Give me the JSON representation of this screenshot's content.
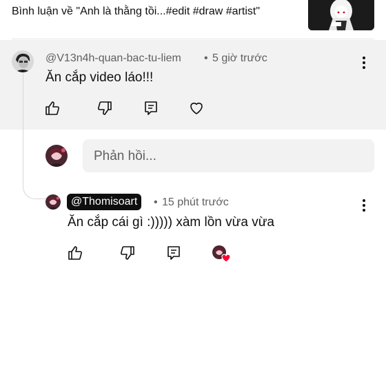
{
  "header": {
    "title": "Bình luận về \"Anh là thằng tồi...#edit #draw #artist\"",
    "thumbnail_icon": "video-thumbnail"
  },
  "comment": {
    "author": "@V13n4h-quan-bac-tu-liem",
    "separator": "•",
    "time": "5 giờ trước",
    "text": "Ăn cắp video láo!!!",
    "actions": [
      "like-icon",
      "dislike-icon",
      "reply-icon",
      "heart-icon"
    ]
  },
  "reply_input": {
    "placeholder": "Phản hồi..."
  },
  "reply": {
    "author": "@Thomisoart",
    "separator": "•",
    "time": "15 phút trước",
    "text": "Ăn cắp cái gì :))))) xàm lồn vừa vừa",
    "actions": [
      "like-icon",
      "dislike-icon",
      "reply-icon",
      "creator-heart-icon"
    ]
  },
  "colors": {
    "highlight_bg": "#f2f2f2",
    "secondary_text": "#606060",
    "heart_red": "#ff0033"
  }
}
